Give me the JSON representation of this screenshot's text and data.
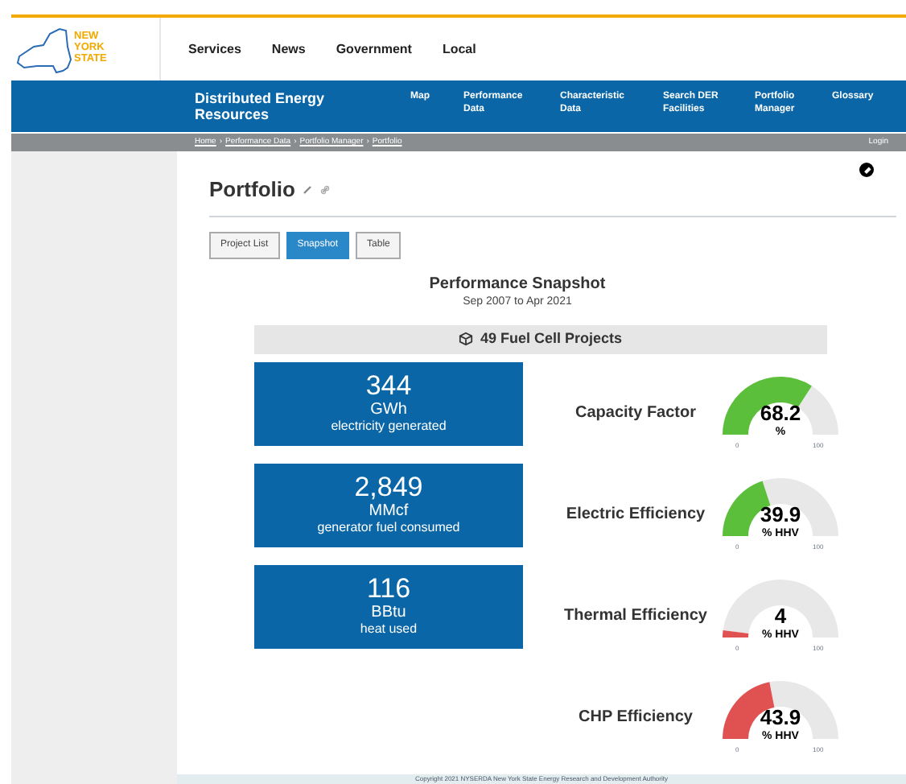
{
  "logo": {
    "lines": [
      "NEW",
      "YORK",
      "STATE"
    ]
  },
  "top_nav": [
    "Services",
    "News",
    "Government",
    "Local"
  ],
  "site_title": "Distributed Energy Resources",
  "main_nav": [
    "Map",
    "Performance Data",
    "Characteristic Data",
    "Search DER Facilities",
    "Portfolio Manager",
    "Glossary"
  ],
  "breadcrumbs": [
    "Home",
    "Performance Data",
    "Portfolio Manager",
    "Portfolio"
  ],
  "breadcrumb_separator": "›",
  "login": "Login",
  "page_title": "Portfolio",
  "tabs": [
    {
      "label": "Project List",
      "selected": false
    },
    {
      "label": "Snapshot",
      "selected": true
    },
    {
      "label": "Table",
      "selected": false
    }
  ],
  "snapshot": {
    "title": "Performance Snapshot",
    "period": "Sep 2007 to Apr 2021",
    "projects": "49 Fuel Cell Projects"
  },
  "totals": [
    {
      "value": "344",
      "unit": "GWh",
      "caption": "electricity generated"
    },
    {
      "value": "2,849",
      "unit": "MMcf",
      "caption": "generator fuel consumed"
    },
    {
      "value": "116",
      "unit": "BBtu",
      "caption": "heat used"
    }
  ],
  "gauges": [
    {
      "label": "Capacity Factor",
      "value": "68.2",
      "unit": "%",
      "color": "#5cbf3c",
      "min": "0",
      "max": "100"
    },
    {
      "label": "Electric Efficiency",
      "value": "39.9",
      "unit": "% HHV",
      "color": "#5cbf3c",
      "min": "0",
      "max": "100"
    },
    {
      "label": "Thermal Efficiency",
      "value": "4",
      "unit": "% HHV",
      "color": "#e05252",
      "min": "0",
      "max": "100"
    },
    {
      "label": "CHP Efficiency",
      "value": "43.9",
      "unit": "% HHV",
      "color": "#e05252",
      "min": "0",
      "max": "100"
    }
  ],
  "footer": "Copyright 2021 NYSERDA New York State Energy Research and Development Authority"
}
